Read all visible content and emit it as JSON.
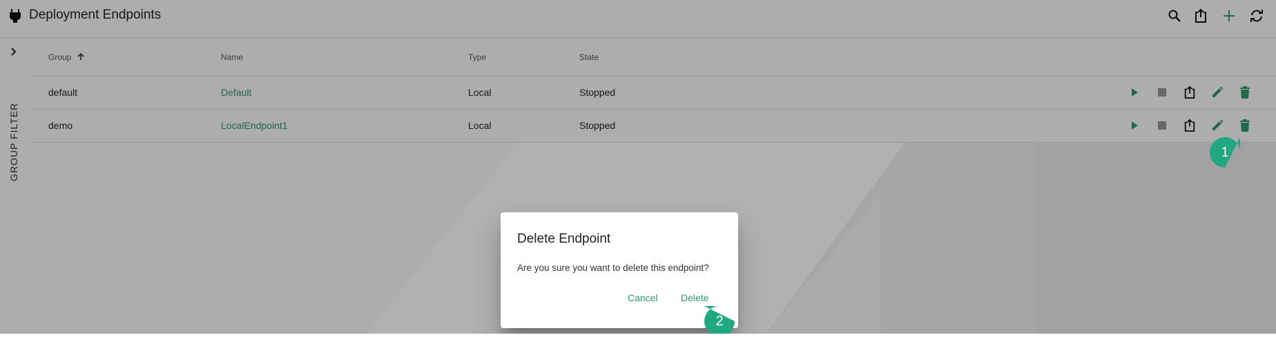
{
  "header": {
    "title": "Deployment Endpoints",
    "app_icon": "plug-icon",
    "actions": [
      {
        "name": "search-button",
        "icon": "search-icon"
      },
      {
        "name": "export-button",
        "icon": "export-icon"
      },
      {
        "name": "add-button",
        "icon": "plus-icon"
      },
      {
        "name": "refresh-button",
        "icon": "refresh-icon"
      }
    ]
  },
  "sidebar": {
    "label": "GROUP FILTER",
    "icon": "chevron-right-icon"
  },
  "table": {
    "columns": [
      {
        "label": "Group",
        "sort": "ascending"
      },
      {
        "label": "Name"
      },
      {
        "label": "Type"
      },
      {
        "label": "State"
      }
    ],
    "rows": [
      {
        "group": "default",
        "name": "Default",
        "type": "Local",
        "state": "Stopped"
      },
      {
        "group": "demo",
        "name": "LocalEndpoint1",
        "type": "Local",
        "state": "Stopped"
      }
    ],
    "row_actions": [
      "play-icon",
      "stop-icon",
      "export-icon",
      "edit-icon",
      "delete-icon"
    ]
  },
  "dialog": {
    "title": "Delete Endpoint",
    "message": "Are you sure you want to delete this endpoint?",
    "cancel_label": "Cancel",
    "delete_label": "Delete"
  },
  "callouts": [
    {
      "number": "1"
    },
    {
      "number": "2"
    }
  ],
  "colors": {
    "accent": "#2e9a70",
    "callout": "#1fa882",
    "overlay": "rgba(0,0,0,0.32)"
  }
}
